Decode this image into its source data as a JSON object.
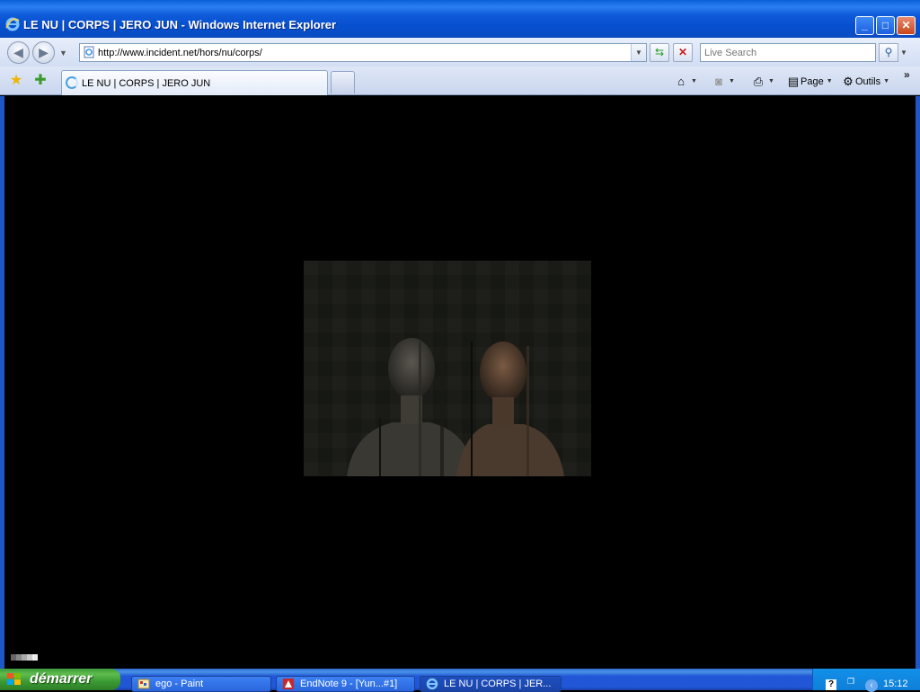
{
  "window": {
    "title": "LE NU | CORPS | JERO JUN - Windows Internet Explorer",
    "minimize": "_",
    "maximize": "□",
    "close": "✕"
  },
  "address_bar": {
    "url": "http://www.incident.net/hors/nu/corps/",
    "back_icon": "back-arrow-icon",
    "forward_icon": "forward-arrow-icon",
    "refresh_icon": "refresh-icon",
    "stop_icon": "stop-icon"
  },
  "search": {
    "placeholder": "Live Search"
  },
  "tabs": [
    {
      "label": "LE NU | CORPS | JERO JUN"
    }
  ],
  "command_bar": {
    "page_label": "Page",
    "tools_label": "Outils"
  },
  "taskbar": {
    "start_label": "démarrer",
    "tasks": [
      {
        "label": "ego - Paint"
      },
      {
        "label": "EndNote 9 - [Yun...#1]"
      },
      {
        "label": "LE NU | CORPS | JER..."
      }
    ],
    "clock": "15:12",
    "help": "?"
  },
  "colors": {
    "title_bar": "#0a5fd8",
    "taskbar": "#2157d7",
    "start_button": "#3a9a32",
    "content_bg": "#000000"
  }
}
